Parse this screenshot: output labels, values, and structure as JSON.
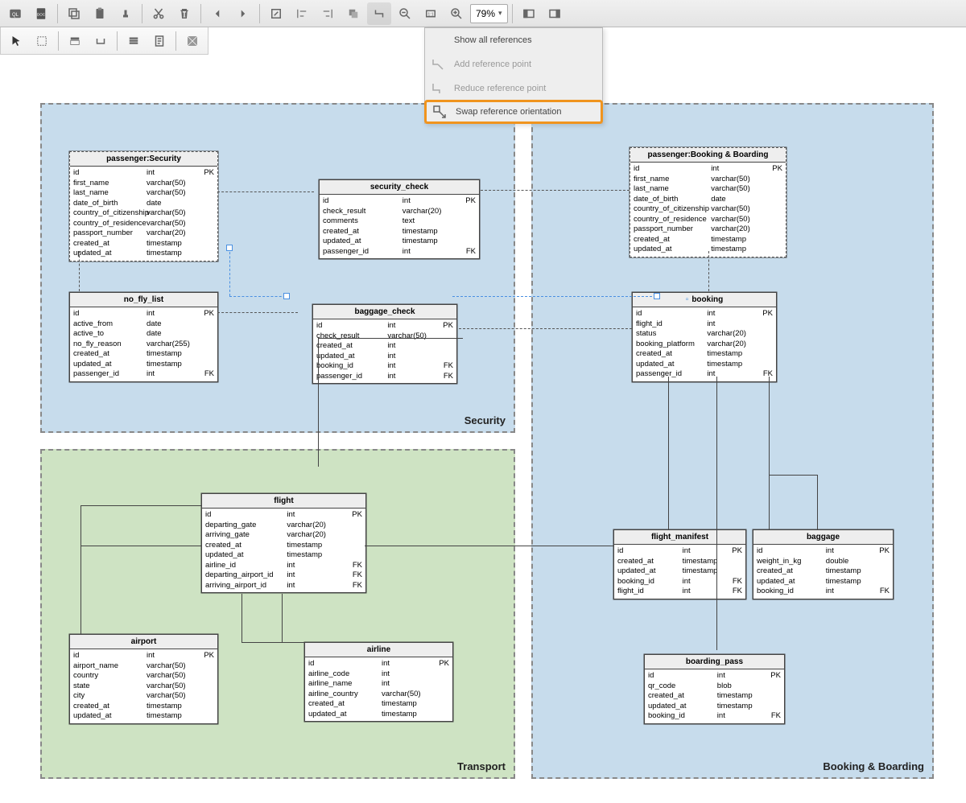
{
  "toolbar": {
    "zoom": "79%",
    "menu": {
      "show_all": "Show all references",
      "add_point": "Add reference point",
      "reduce_point": "Reduce reference point",
      "swap": "Swap reference orientation"
    }
  },
  "regions": {
    "security": "Security",
    "transport": "Transport",
    "booking": "Booking & Boarding"
  },
  "entities": {
    "passenger_sec": {
      "title": "passenger:Security",
      "rows": [
        [
          "id",
          "int",
          "PK"
        ],
        [
          "first_name",
          "varchar(50)",
          ""
        ],
        [
          "last_name",
          "varchar(50)",
          ""
        ],
        [
          "date_of_birth",
          "date",
          ""
        ],
        [
          "country_of_citizenship",
          "varchar(50)",
          ""
        ],
        [
          "country_of_residence",
          "varchar(50)",
          ""
        ],
        [
          "passport_number",
          "varchar(20)",
          ""
        ],
        [
          "created_at",
          "timestamp",
          ""
        ],
        [
          "updated_at",
          "timestamp",
          ""
        ]
      ]
    },
    "security_check": {
      "title": "security_check",
      "rows": [
        [
          "id",
          "int",
          "PK"
        ],
        [
          "check_result",
          "varchar(20)",
          ""
        ],
        [
          "comments",
          "text",
          ""
        ],
        [
          "created_at",
          "timestamp",
          ""
        ],
        [
          "updated_at",
          "timestamp",
          ""
        ],
        [
          "passenger_id",
          "int",
          "FK"
        ]
      ]
    },
    "passenger_book": {
      "title": "passenger:Booking & Boarding",
      "rows": [
        [
          "id",
          "int",
          "PK"
        ],
        [
          "first_name",
          "varchar(50)",
          ""
        ],
        [
          "last_name",
          "varchar(50)",
          ""
        ],
        [
          "date_of_birth",
          "date",
          ""
        ],
        [
          "country_of_citizenship",
          "varchar(50)",
          ""
        ],
        [
          "country_of_residence",
          "varchar(50)",
          ""
        ],
        [
          "passport_number",
          "varchar(20)",
          ""
        ],
        [
          "created_at",
          "timestamp",
          ""
        ],
        [
          "updated_at",
          "timestamp",
          ""
        ]
      ]
    },
    "no_fly_list": {
      "title": "no_fly_list",
      "rows": [
        [
          "id",
          "int",
          "PK"
        ],
        [
          "active_from",
          "date",
          ""
        ],
        [
          "active_to",
          "date",
          ""
        ],
        [
          "no_fly_reason",
          "varchar(255)",
          ""
        ],
        [
          "created_at",
          "timestamp",
          ""
        ],
        [
          "updated_at",
          "timestamp",
          ""
        ],
        [
          "passenger_id",
          "int",
          "FK"
        ]
      ]
    },
    "baggage_check": {
      "title": "baggage_check",
      "rows": [
        [
          "id",
          "int",
          "PK"
        ],
        [
          "check_result",
          "varchar(50)",
          ""
        ],
        [
          "created_at",
          "int",
          ""
        ],
        [
          "updated_at",
          "int",
          ""
        ],
        [
          "booking_id",
          "int",
          "FK"
        ],
        [
          "passenger_id",
          "int",
          "FK"
        ]
      ]
    },
    "booking": {
      "title": "booking",
      "rows": [
        [
          "id",
          "int",
          "PK"
        ],
        [
          "flight_id",
          "int",
          ""
        ],
        [
          "status",
          "varchar(20)",
          ""
        ],
        [
          "booking_platform",
          "varchar(20)",
          ""
        ],
        [
          "created_at",
          "timestamp",
          ""
        ],
        [
          "updated_at",
          "timestamp",
          ""
        ],
        [
          "passenger_id",
          "int",
          "FK"
        ]
      ]
    },
    "flight": {
      "title": "flight",
      "rows": [
        [
          "id",
          "int",
          "PK"
        ],
        [
          "departing_gate",
          "varchar(20)",
          ""
        ],
        [
          "arriving_gate",
          "varchar(20)",
          ""
        ],
        [
          "created_at",
          "timestamp",
          ""
        ],
        [
          "updated_at",
          "timestamp",
          ""
        ],
        [
          "airline_id",
          "int",
          "FK"
        ],
        [
          "departing_airport_id",
          "int",
          "FK"
        ],
        [
          "arriving_airport_id",
          "int",
          "FK"
        ]
      ]
    },
    "airport": {
      "title": "airport",
      "rows": [
        [
          "id",
          "int",
          "PK"
        ],
        [
          "airport_name",
          "varchar(50)",
          ""
        ],
        [
          "country",
          "varchar(50)",
          ""
        ],
        [
          "state",
          "varchar(50)",
          ""
        ],
        [
          "city",
          "varchar(50)",
          ""
        ],
        [
          "created_at",
          "timestamp",
          ""
        ],
        [
          "updated_at",
          "timestamp",
          ""
        ]
      ]
    },
    "airline": {
      "title": "airline",
      "rows": [
        [
          "id",
          "int",
          "PK"
        ],
        [
          "airline_code",
          "int",
          ""
        ],
        [
          "airline_name",
          "int",
          ""
        ],
        [
          "airline_country",
          "varchar(50)",
          ""
        ],
        [
          "created_at",
          "timestamp",
          ""
        ],
        [
          "updated_at",
          "timestamp",
          ""
        ]
      ]
    },
    "flight_manifest": {
      "title": "flight_manifest",
      "rows": [
        [
          "id",
          "int",
          "PK"
        ],
        [
          "created_at",
          "timestamp",
          ""
        ],
        [
          "updated_at",
          "timestamp",
          ""
        ],
        [
          "booking_id",
          "int",
          "FK"
        ],
        [
          "flight_id",
          "int",
          "FK"
        ]
      ]
    },
    "baggage": {
      "title": "baggage",
      "rows": [
        [
          "id",
          "int",
          "PK"
        ],
        [
          "weight_in_kg",
          "double",
          ""
        ],
        [
          "created_at",
          "timestamp",
          ""
        ],
        [
          "updated_at",
          "timestamp",
          ""
        ],
        [
          "booking_id",
          "int",
          "FK"
        ]
      ]
    },
    "boarding_pass": {
      "title": "boarding_pass",
      "rows": [
        [
          "id",
          "int",
          "PK"
        ],
        [
          "qr_code",
          "blob",
          ""
        ],
        [
          "created_at",
          "timestamp",
          ""
        ],
        [
          "updated_at",
          "timestamp",
          ""
        ],
        [
          "booking_id",
          "int",
          "FK"
        ]
      ]
    }
  }
}
